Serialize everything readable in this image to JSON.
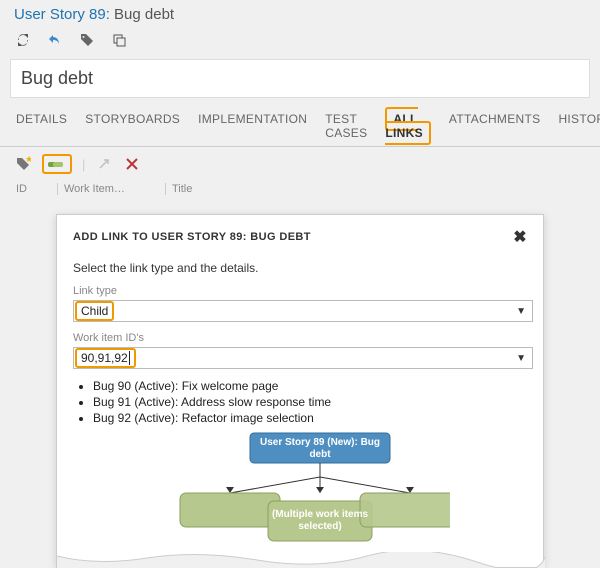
{
  "header": {
    "title_prefix": "User Story 89",
    "title_separator": ": ",
    "title_name": "Bug debt"
  },
  "name_field": "Bug debt",
  "tabs": {
    "details": "DETAILS",
    "storyboards": "STORYBOARDS",
    "implementation": "IMPLEMENTATION",
    "testcases": "TEST CASES",
    "alllinks": "ALL LINKS",
    "attachments": "ATTACHMENTS",
    "history": "HISTORY"
  },
  "columns": {
    "id": "ID",
    "workitem": "Work Item…",
    "title": "Title"
  },
  "dialog": {
    "title": "ADD LINK TO USER STORY 89: BUG DEBT",
    "instruction": "Select the link type and the details.",
    "link_type_label": "Link type",
    "link_type_value": "Child",
    "ids_label": "Work item ID's",
    "ids_value": "90,91,92",
    "items": [
      "Bug 90 (Active): Fix welcome page",
      "Bug 91 (Active): Address slow response time",
      "Bug 92 (Active): Refactor image selection"
    ],
    "diagram_top_line1": "User Story 89 (New): Bug",
    "diagram_top_line2": "debt",
    "diagram_bottom_line1": "(Multiple work items",
    "diagram_bottom_line2": "selected)"
  }
}
